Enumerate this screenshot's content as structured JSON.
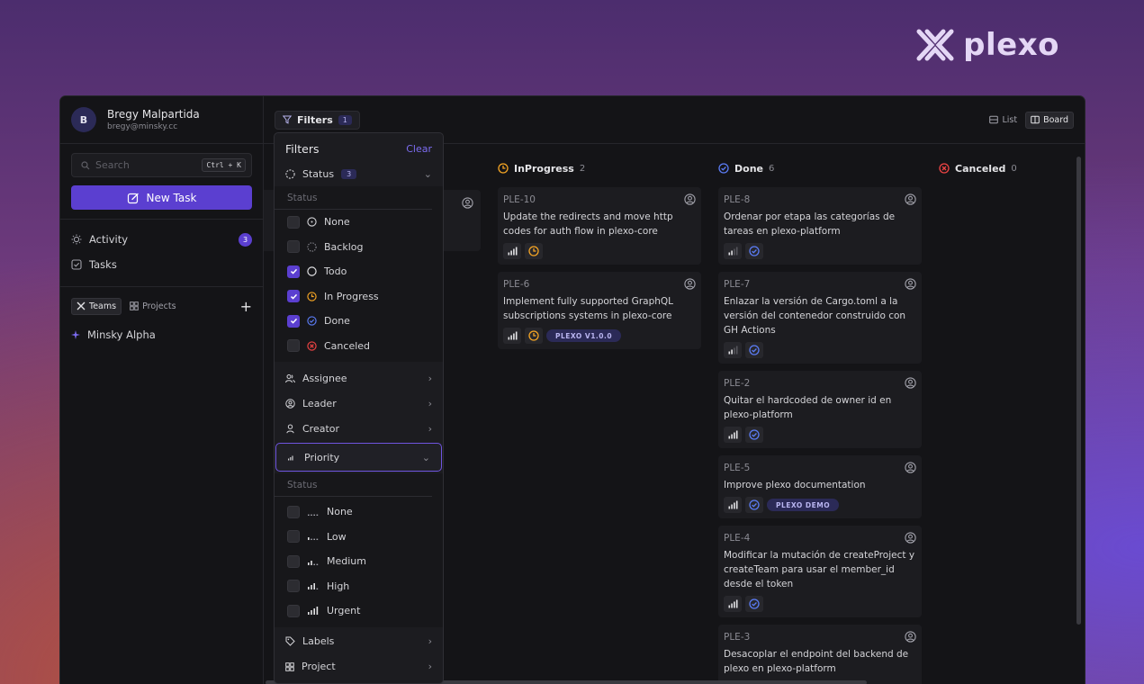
{
  "brand": {
    "name": "plexo"
  },
  "user": {
    "initial": "B",
    "name": "Bregy Malpartida",
    "email": "bregy@minsky.cc"
  },
  "sidebar": {
    "search_placeholder": "Search",
    "search_shortcut": "Ctrl + K",
    "new_task_label": "New Task",
    "nav": [
      {
        "label": "Activity",
        "badge": "3"
      },
      {
        "label": "Tasks"
      }
    ],
    "segments": {
      "teams": "Teams",
      "projects": "Projects"
    },
    "teams": [
      {
        "label": "Minsky Alpha"
      }
    ]
  },
  "topbar": {
    "filters_label": "Filters",
    "filters_count": "1",
    "views": {
      "list": "List",
      "board": "Board"
    }
  },
  "filters": {
    "title": "Filters",
    "clear": "Clear",
    "status_label": "Status",
    "status_count": "3",
    "status_sub": "Status",
    "status_options": [
      {
        "label": "None",
        "checked": false
      },
      {
        "label": "Backlog",
        "checked": false
      },
      {
        "label": "Todo",
        "checked": true
      },
      {
        "label": "In Progress",
        "checked": true
      },
      {
        "label": "Done",
        "checked": true
      },
      {
        "label": "Canceled",
        "checked": false
      }
    ],
    "assignee": "Assignee",
    "leader": "Leader",
    "creator": "Creator",
    "priority": "Priority",
    "priority_sub": "Status",
    "priority_options": [
      {
        "label": "None",
        "checked": false
      },
      {
        "label": "Low",
        "checked": false
      },
      {
        "label": "Medium",
        "checked": false
      },
      {
        "label": "High",
        "checked": false
      },
      {
        "label": "Urgent",
        "checked": false
      }
    ],
    "labels": "Labels",
    "project": "Project"
  },
  "columns": {
    "inprogress": {
      "title": "InProgress",
      "count": "2",
      "cards": [
        {
          "id": "PLE-10",
          "title": "Update the redirects and move http codes for auth flow in plexo-core"
        },
        {
          "id": "PLE-6",
          "title": "Implement fully supported GraphQL subscriptions systems in plexo-core",
          "label": "PLEXO V1.0.0"
        }
      ]
    },
    "done": {
      "title": "Done",
      "count": "6",
      "cards": [
        {
          "id": "PLE-8",
          "title": "Ordenar por etapa las categorías de tareas en plexo-platform"
        },
        {
          "id": "PLE-7",
          "title": "Enlazar la versión de Cargo.toml a la versión del contenedor construido con GH Actions"
        },
        {
          "id": "PLE-2",
          "title": "Quitar el hardcoded de owner id en plexo-platform"
        },
        {
          "id": "PLE-5",
          "title": "Improve plexo documentation",
          "label": "PLEXO DEMO"
        },
        {
          "id": "PLE-4",
          "title": "Modificar la mutación de createProject y createTeam para usar el member_id desde el token"
        },
        {
          "id": "PLE-3",
          "title": "Desacoplar el endpoint del backend de plexo en plexo-platform"
        }
      ]
    },
    "canceled": {
      "title": "Canceled",
      "count": "0"
    }
  },
  "colors": {
    "accent": "#5b3fd0",
    "inprogress": "#f5a524",
    "done": "#5b7cf5",
    "canceled": "#ef4444"
  }
}
